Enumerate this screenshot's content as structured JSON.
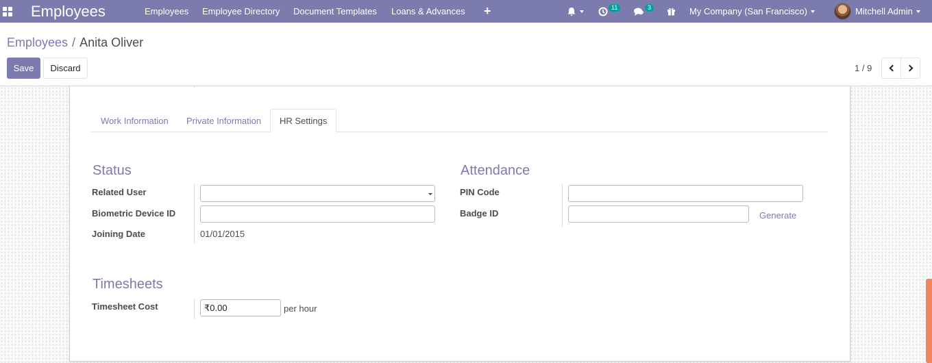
{
  "navbar": {
    "brand": "Employees",
    "menu": [
      "Employees",
      "Employee Directory",
      "Document Templates",
      "Loans & Advances"
    ],
    "plus": "+",
    "activity_count": "11",
    "message_count": "3",
    "company": "My Company (San Francisco)",
    "user": "Mitchell Admin",
    "color": "#7c7bad"
  },
  "breadcrumb": {
    "parent": "Employees",
    "separator": "/",
    "current": "Anita Oliver"
  },
  "buttons": {
    "save": "Save",
    "discard": "Discard"
  },
  "pager": {
    "text": "1 / 9"
  },
  "tabs": [
    "Work Information",
    "Private Information",
    "HR Settings"
  ],
  "active_tab": "HR Settings",
  "status": {
    "title": "Status",
    "related_user_label": "Related User",
    "related_user_value": "",
    "biometric_label": "Biometric Device ID",
    "biometric_value": "",
    "joining_date_label": "Joining Date",
    "joining_date_value": "01/01/2015"
  },
  "attendance": {
    "title": "Attendance",
    "pin_label": "PIN Code",
    "pin_value": "",
    "badge_label": "Badge ID",
    "badge_value": "",
    "generate_label": "Generate"
  },
  "timesheets": {
    "title": "Timesheets",
    "cost_label": "Timesheet Cost",
    "cost_value": "₹0.00",
    "unit": "per hour"
  },
  "colors": {
    "accent": "#7c7bad",
    "badge": "#00a09d",
    "scrollbar": "#f0845a"
  }
}
